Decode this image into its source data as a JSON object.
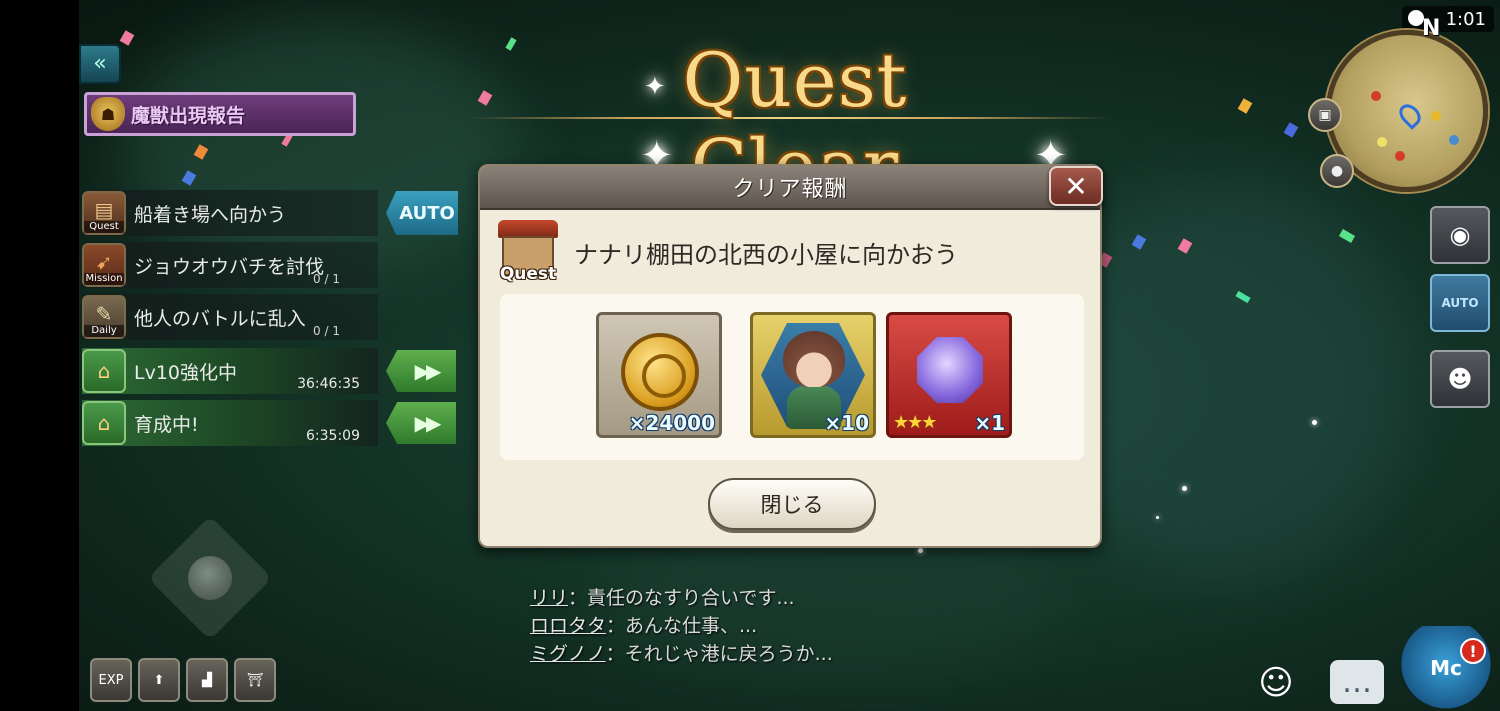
{
  "title": "Quest Clear",
  "beast_report": {
    "label": "魔獣出現報告"
  },
  "auto_label": "AUTO",
  "fast_forward_glyph": "▶▶",
  "tasks": [
    {
      "type_caption": "Quest",
      "label": "船着き場へ向かう",
      "count": ""
    },
    {
      "type_caption": "Mission",
      "label": "ジョウオウバチを討伐",
      "count": "0 / 1"
    },
    {
      "type_caption": "Daily",
      "label": "他人のバトルに乱入",
      "count": "0 / 1"
    }
  ],
  "timers": [
    {
      "label": "Lv10強化中",
      "time": "36:46:35"
    },
    {
      "label": "育成中!",
      "time": "6:35:09"
    }
  ],
  "dialog": {
    "header": "クリア報酬",
    "close_glyph": "✕",
    "quest_caption": "Quest",
    "quest_name": "ナナリ棚田の北西の小屋に向かおう",
    "rewards": [
      {
        "kind": "gold-coin",
        "qty": "×24000",
        "stars": ""
      },
      {
        "kind": "character",
        "qty": "×10",
        "stars": ""
      },
      {
        "kind": "purple-gem",
        "qty": "×1",
        "stars": "★★★"
      }
    ],
    "close_button": "閉じる"
  },
  "chat": [
    {
      "speaker": "リリ",
      "text": "：責任のなすり合いです..."
    },
    {
      "speaker": "ロロタタ",
      "text": "：あんな仕事、..."
    },
    {
      "speaker": "ミグノノ",
      "text": "：それじゃ港に戻ろうか..."
    }
  ],
  "clock": {
    "text": "1:01",
    "compass": "N"
  },
  "side_buttons": {
    "auto_label": "AUTO"
  },
  "bottom_buttons": {
    "exp_label": "EXP"
  },
  "mc": {
    "label": "Mc",
    "badge": "!"
  }
}
